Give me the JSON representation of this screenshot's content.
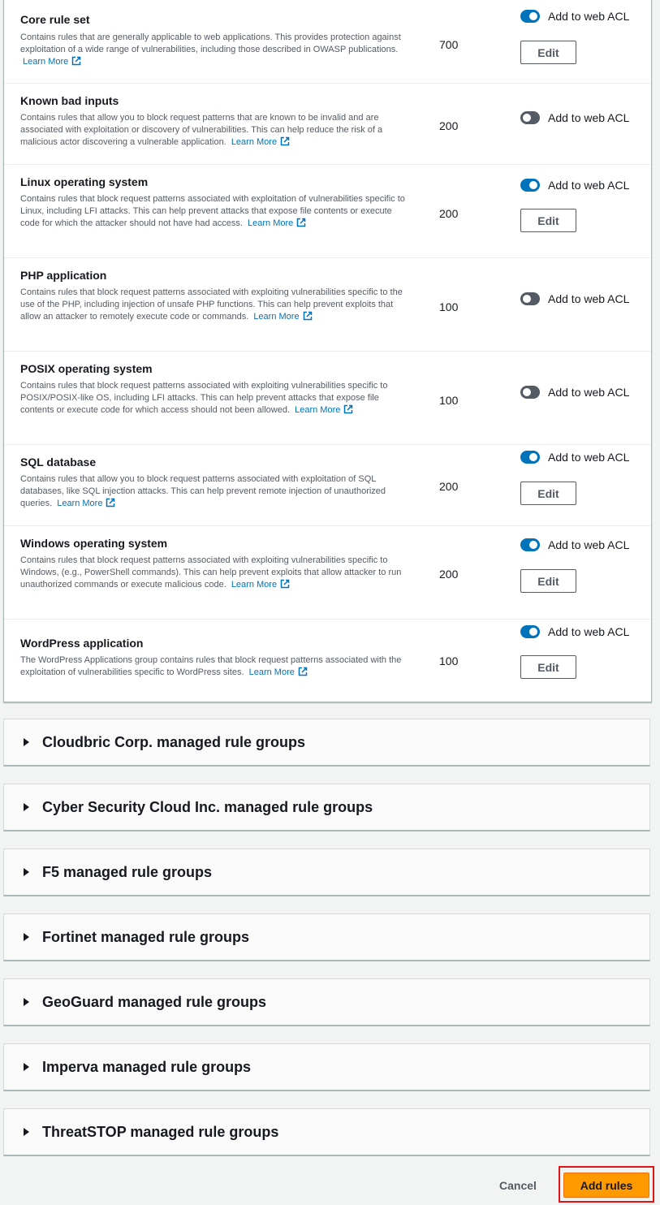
{
  "rules": [
    {
      "title": "Core rule set",
      "description": "Contains rules that are generally applicable to web applications. This provides protection against exploitation of a wide range of vulnerabilities, including those described in OWASP publications.",
      "learn_more": "Learn More",
      "capacity": "700",
      "enabled": true,
      "toggle_label": "Add to web ACL",
      "edit_label": "Edit"
    },
    {
      "title": "Known bad inputs",
      "description": "Contains rules that allow you to block request patterns that are known to be invalid and are associated with exploitation or discovery of vulnerabilities. This can help reduce the risk of a malicious actor discovering a vulnerable application.",
      "learn_more": "Learn More",
      "capacity": "200",
      "enabled": false,
      "toggle_label": "Add to web ACL"
    },
    {
      "title": "Linux operating system",
      "description": "Contains rules that block request patterns associated with exploitation of vulnerabilities specific to Linux, including LFI attacks. This can help prevent attacks that expose file contents or execute code for which the attacker should not have had access.",
      "learn_more": "Learn More",
      "capacity": "200",
      "enabled": true,
      "toggle_label": "Add to web ACL",
      "edit_label": "Edit"
    },
    {
      "title": "PHP application",
      "description": "Contains rules that block request patterns associated with exploiting vulnerabilities specific to the use of the PHP, including injection of unsafe PHP functions. This can help prevent exploits that allow an attacker to remotely execute code or commands.",
      "learn_more": "Learn More",
      "capacity": "100",
      "enabled": false,
      "toggle_label": "Add to web ACL"
    },
    {
      "title": "POSIX operating system",
      "description": "Contains rules that block request patterns associated with exploiting vulnerabilities specific to POSIX/POSIX-like OS, including LFI attacks. This can help prevent attacks that expose file contents or execute code for which access should not been allowed.",
      "learn_more": "Learn More",
      "capacity": "100",
      "enabled": false,
      "toggle_label": "Add to web ACL"
    },
    {
      "title": "SQL database",
      "description": "Contains rules that allow you to block request patterns associated with exploitation of SQL databases, like SQL injection attacks. This can help prevent remote injection of unauthorized queries.",
      "learn_more": "Learn More",
      "capacity": "200",
      "enabled": true,
      "toggle_label": "Add to web ACL",
      "edit_label": "Edit"
    },
    {
      "title": "Windows operating system",
      "description": "Contains rules that block request patterns associated with exploiting vulnerabilities specific to Windows, (e.g., PowerShell commands). This can help prevent exploits that allow attacker to run unauthorized commands or execute malicious code.",
      "learn_more": "Learn More",
      "capacity": "200",
      "enabled": true,
      "toggle_label": "Add to web ACL",
      "edit_label": "Edit"
    },
    {
      "title": "WordPress application",
      "description": "The WordPress Applications group contains rules that block request patterns associated with the exploitation of vulnerabilities specific to WordPress sites.",
      "learn_more": "Learn More",
      "capacity": "100",
      "enabled": true,
      "toggle_label": "Add to web ACL",
      "edit_label": "Edit"
    }
  ],
  "vendor_groups": [
    {
      "title": "Cloudbric Corp. managed rule groups"
    },
    {
      "title": "Cyber Security Cloud Inc. managed rule groups"
    },
    {
      "title": "F5 managed rule groups"
    },
    {
      "title": "Fortinet managed rule groups"
    },
    {
      "title": "GeoGuard managed rule groups"
    },
    {
      "title": "Imperva managed rule groups"
    },
    {
      "title": "ThreatSTOP managed rule groups"
    }
  ],
  "footer": {
    "cancel_label": "Cancel",
    "add_rules_label": "Add rules"
  },
  "colors": {
    "toggle_on": "#0073bb",
    "toggle_off": "#545b64",
    "primary_button": "#ff9900",
    "link": "#0073bb",
    "highlight_border": "#e01414"
  },
  "icons": {
    "external_link": "external-link-icon",
    "expand": "caret-right-icon"
  }
}
